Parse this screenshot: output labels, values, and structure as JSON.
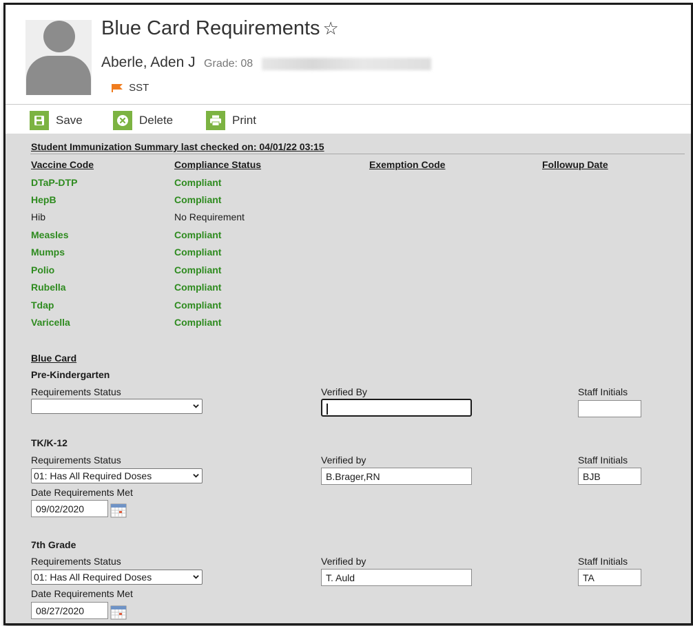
{
  "header": {
    "title": "Blue Card Requirements",
    "star_icon": "star-outline-icon",
    "student_name": "Aberle, Aden J",
    "grade_label": "Grade: 08",
    "flag_label": "SST",
    "flag_color": "#f07c1e"
  },
  "toolbar": {
    "save_label": "Save",
    "delete_label": "Delete",
    "print_label": "Print",
    "icon_color": "#7cb342"
  },
  "summary": {
    "checked_label": "Student Immunization Summary last checked on: 04/01/22 03:15",
    "columns": [
      "Vaccine Code",
      "Compliance Status",
      "Exemption Code",
      "Followup Date"
    ],
    "rows": [
      {
        "vaccine": "DTaP-DTP",
        "status": "Compliant"
      },
      {
        "vaccine": "HepB",
        "status": "Compliant"
      },
      {
        "vaccine": "Hib",
        "status": "No Requirement"
      },
      {
        "vaccine": "Measles",
        "status": "Compliant"
      },
      {
        "vaccine": "Mumps",
        "status": "Compliant"
      },
      {
        "vaccine": "Polio",
        "status": "Compliant"
      },
      {
        "vaccine": "Rubella",
        "status": "Compliant"
      },
      {
        "vaccine": "Tdap",
        "status": "Compliant"
      },
      {
        "vaccine": "Varicella",
        "status": "Compliant"
      }
    ],
    "compliant_color": "#2e8b1f"
  },
  "blue_card": {
    "heading": "Blue Card",
    "sections": [
      {
        "name": "Pre-Kindergarten",
        "status_label": "Requirements Status",
        "status_value": "",
        "verified_label": "Verified By",
        "verified_value": "",
        "initials_label": "Staff Initials",
        "initials_value": ""
      },
      {
        "name": "TK/K-12",
        "status_label": "Requirements Status",
        "status_value": "01: Has All Required Doses",
        "verified_label": "Verified by",
        "verified_value": "B.Brager,RN",
        "initials_label": "Staff Initials",
        "initials_value": "BJB",
        "date_label": "Date Requirements Met",
        "date_value": "09/02/2020"
      },
      {
        "name": "7th Grade",
        "status_label": "Requirements Status",
        "status_value": "01: Has All Required Doses",
        "verified_label": "Verified by",
        "verified_value": "T. Auld",
        "initials_label": "Staff Initials",
        "initials_value": "TA",
        "date_label": "Date Requirements Met",
        "date_value": "08/27/2020"
      }
    ]
  }
}
